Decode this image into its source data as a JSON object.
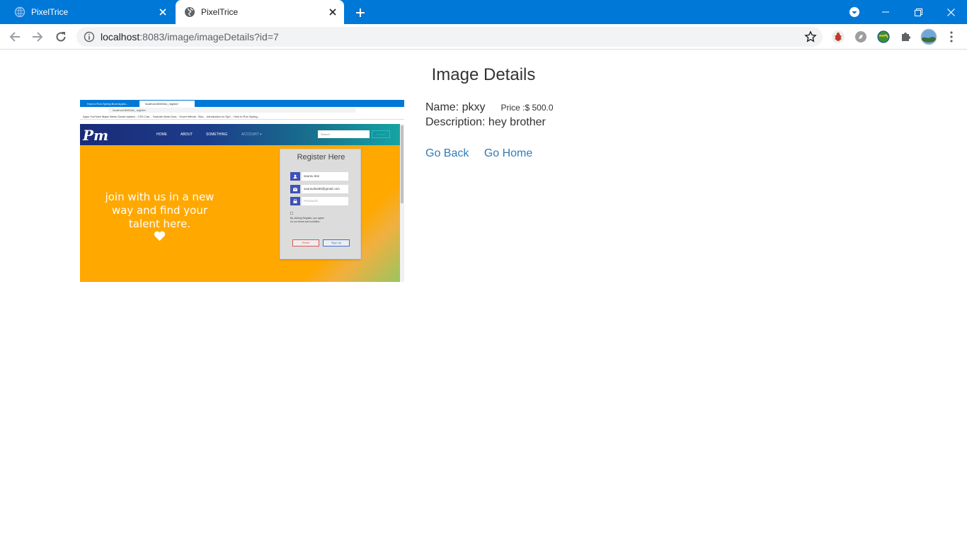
{
  "browser": {
    "tabs": [
      {
        "label": "PixelTrice",
        "active": false
      },
      {
        "label": "PixelTrice",
        "active": true
      }
    ],
    "url_host": "localhost",
    "url_path": ":8083/image/imageDetails?id=7"
  },
  "page": {
    "title": "Image Details",
    "name_text": "Name: pkxy",
    "price_text": "Price :$ 500.0",
    "description_text": "Description: hey brother",
    "go_back": "Go Back",
    "go_home": "Go Home"
  },
  "preview": {
    "tab1": "How to Run Spring Boot Applic...",
    "tab2": "localhost:8083/do_register",
    "url": "localhost:8083/do_register",
    "bookmarks": "Apps   YouTube   Maps   News   Gmail   maders - CSS Can...   Youtube Mark Dow...   Hover effects - Bou...   Introduction to Spri...   How to Run Spring...",
    "logo": "Pm",
    "nav": [
      "HOME",
      "ABOUT",
      "SOMETHING",
      "ACCOUNT ▾"
    ],
    "search_placeholder": "Search",
    "search_button": "Search",
    "tagline": "join with us in a new way and find your talent here.",
    "card_title": "Register Here",
    "username": "saurav das",
    "email": "sauravdas99@gmail.com",
    "password_placeholder": "Password",
    "terms": "By clicking Register, you agree on our terms and condition",
    "reset": "Reset",
    "signup": "Sign Up"
  },
  "colors": {
    "chrome_blue": "#0078d7",
    "link": "#337ab7",
    "orange": "#ffa800"
  }
}
